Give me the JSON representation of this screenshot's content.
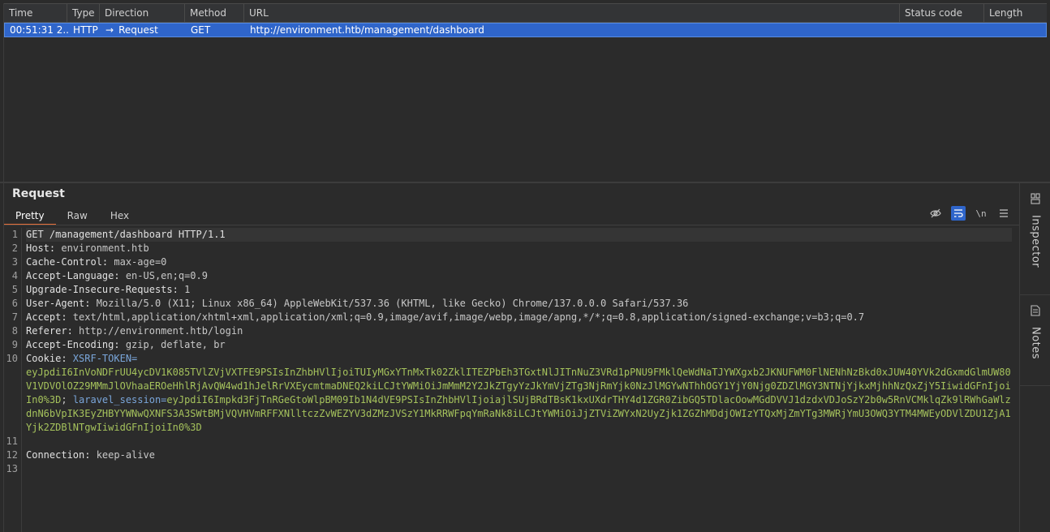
{
  "history": {
    "columns": [
      "Time",
      "Type",
      "Direction",
      "Method",
      "URL",
      "Status code",
      "Length"
    ],
    "rows": [
      {
        "time": "00:51:31 2...",
        "type": "HTTP",
        "direction": "Request",
        "method": "GET",
        "url": "http://environment.htb/management/dashboard",
        "status": "",
        "length": ""
      }
    ],
    "selected_color": "#2f65ca"
  },
  "request": {
    "title": "Request",
    "tabs": [
      "Pretty",
      "Raw",
      "Hex"
    ],
    "active_tab": "Pretty",
    "toolbar": {
      "hide_icon": "eye-slash-icon",
      "wrap_icon": "wrap-lines-icon",
      "newline_label": "\\n",
      "menu_icon": "hamburger-menu-icon"
    },
    "line_numbers": [
      "1",
      "2",
      "3",
      "4",
      "5",
      "6",
      "7",
      "8",
      "9",
      "10",
      "11",
      "12",
      "13"
    ],
    "lines": {
      "l1": "GET /management/dashboard HTTP/1.1",
      "l2k": "Host:",
      "l2v": " environment.htb",
      "l3k": "Cache-Control:",
      "l3v": " max-age=0",
      "l4k": "Accept-Language:",
      "l4v": " en-US,en;q=0.9",
      "l5k": "Upgrade-Insecure-Requests:",
      "l5v": " 1",
      "l6k": "User-Agent:",
      "l6v": " Mozilla/5.0 (X11; Linux x86_64) AppleWebKit/537.36 (KHTML, like Gecko) Chrome/137.0.0.0 Safari/537.36",
      "l7k": "Accept:",
      "l7v": " text/html,application/xhtml+xml,application/xml;q=0.9,image/avif,image/webp,image/apng,*/*;q=0.8,application/signed-exchange;v=b3;q=0.7",
      "l8k": "Referer:",
      "l8v": " http://environment.htb/login",
      "l9k": "Accept-Encoding:",
      "l9v": " gzip, deflate, br",
      "l10k": "Cookie:",
      "l10name1": " XSRF-TOKEN=",
      "xsrf_value": "eyJpdiI6InVoNDFrUU4ycDV1K085TVlZVjVXTFE9PSIsInZhbHVlIjoiTUIyMGxYTnMxTk02ZklITEZPbEh3TGxtNlJITnNuZ3VRd1pPNU9FMklQeWdNaTJYWXgxb2JKNUFWM0FlNENhNzBkd0xJUW40YVk2dGxmdGlmUW80V1VDVOlOZ29MMmJlOVhaaEROeHhlRjAvQW4wd1hJelRrVXEycmtmaDNEQ2kiLCJtYWMiOiJmMmM2Y2JkZTgyYzJkYmVjZTg3NjRmYjk0NzJlMGYwNThhOGY1YjY0Njg0ZDZlMGY3NTNjYjkxMjhhNzQxZjY5IiwidGFnIjoiIn0%3D",
      "cookie_sep": "; ",
      "l10name2": "laravel_session=",
      "session_value": "eyJpdiI6Impkd3FjTnRGeGtoWlpBM09Ib1N4dVE9PSIsInZhbHVlIjoiajlSUjBRdTBsK1kxUXdrTHY4d1ZGR0ZibGQ5TDlacOowMGdDVVJ1dzdxVDJoSzY2b0w5RnVCMklqZk9lRWhGaWlzdnN6bVpIK3EyZHBYYWNwQXNFS3A3SWtBMjVQVHVmRFFXNlltczZvWEZYV3dZMzJVSzY1MkRRWFpqYmRaNk8iLCJtYWMiOiJjZTViZWYxN2UyZjk1ZGZhMDdjOWIzYTQxMjZmYTg3MWRjYmU3OWQ3YTM4MWEyODVlZDU1ZjA1Yjk2ZDBlNTgwIiwidGFnIjoiIn0%3D",
      "l11k": "Connection:",
      "l11v": " keep-alive"
    }
  },
  "sidebar": {
    "inspector_label": "Inspector",
    "inspector_icon": "inspector-icon",
    "notes_label": "Notes",
    "notes_icon": "notes-icon"
  }
}
